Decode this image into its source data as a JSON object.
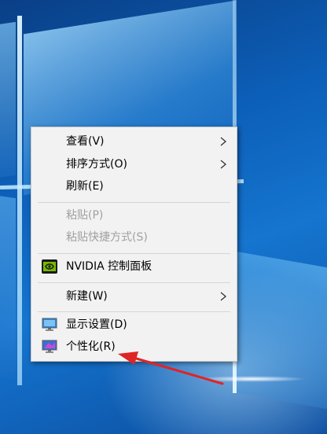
{
  "context_menu": {
    "items": [
      {
        "label": "查看(V)"
      },
      {
        "label": "排序方式(O)"
      },
      {
        "label": "刷新(E)"
      },
      {
        "label": "粘贴(P)"
      },
      {
        "label": "粘贴快捷方式(S)"
      },
      {
        "label": "NVIDIA 控制面板"
      },
      {
        "label": "新建(W)"
      },
      {
        "label": "显示设置(D)"
      },
      {
        "label": "个性化(R)"
      }
    ]
  },
  "icons": {
    "nvidia": "nvidia-logo-icon",
    "display": "monitor-icon",
    "personalize": "personalize-monitor-icon",
    "submenu": "chevron-right-icon"
  },
  "colors": {
    "annotation_arrow": "#e02424",
    "menu_background": "#f2f2f2",
    "disabled_text": "#a0a0a0",
    "nvidia_green": "#76b900"
  }
}
